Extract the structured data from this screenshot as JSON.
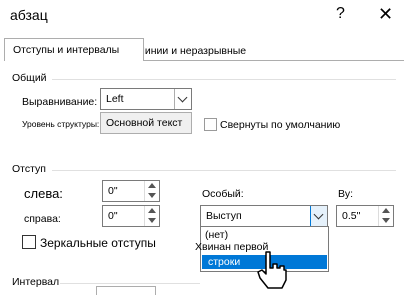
{
  "window": {
    "title": "абзац",
    "help_label": "?",
    "close_label": "✕"
  },
  "tabs": [
    {
      "label": "Отступы и интервалы",
      "active": true
    },
    {
      "label": "Линии и неразрывные перерывы",
      "active": false
    }
  ],
  "general": {
    "title": "Общий",
    "alignment_label": "Выравнивание:",
    "alignment_value": "Left",
    "outline_label": "Уровень структуры:",
    "outline_value": "Основной текст",
    "collapsed_label": "Свернуты по умолчанию",
    "collapsed_checked": false
  },
  "indent": {
    "title": "Отступ",
    "left_label": "слева:",
    "left_value": "0\"",
    "right_label": "справа:",
    "right_value": "0\"",
    "special_label": "Особый:",
    "special_value": "Выступ",
    "by_label": "Ву:",
    "by_value": "0.5\"",
    "mirror_label": "Зеркальные отступы",
    "mirror_checked": false
  },
  "special_dropdown": {
    "options": [
      "(нет)",
      "Хвинан первой",
      "строки"
    ],
    "selected_index": 2
  },
  "spacing": {
    "title": "Интервал"
  },
  "icons": {
    "close": "close-icon",
    "help": "help-icon",
    "dropdown": "chevron-down-icon",
    "spin_up": "arrow-up-icon",
    "spin_down": "arrow-down-icon",
    "cursor": "pointer-cursor-icon"
  },
  "colors": {
    "selection": "#0078d7",
    "border": "#adadad"
  }
}
